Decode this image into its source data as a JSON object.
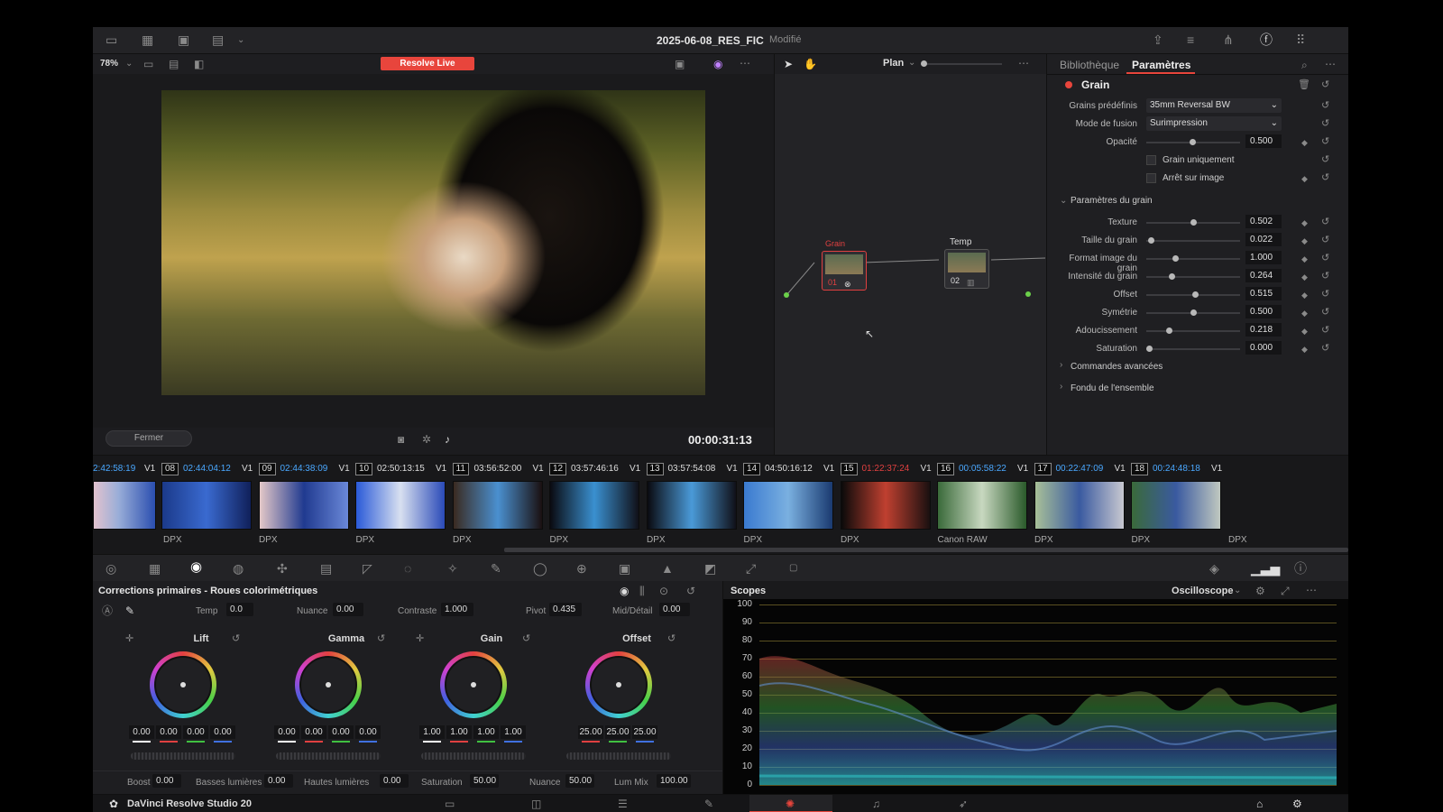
{
  "title_bar": {
    "project": "2025-06-08_RES_FIC",
    "status": "Modifié"
  },
  "viewer": {
    "zoom": "78%",
    "live_button": "Resolve Live",
    "timecode": "00:00:31:13",
    "close_button": "Fermer"
  },
  "node_editor": {
    "mode": "Plan",
    "nodes": [
      {
        "label": "Grain",
        "number": "01"
      },
      {
        "label": "Temp",
        "number": "02"
      }
    ]
  },
  "inspector": {
    "tabs": [
      "Bibliothèque",
      "Paramètres"
    ],
    "effect": "Grain",
    "preset_label": "Grains prédéfinis",
    "preset_value": "35mm Reversal BW",
    "blend_label": "Mode de fusion",
    "blend_value": "Surimpression",
    "opacity_label": "Opacité",
    "opacity_value": "0.500",
    "grain_only": "Grain uniquement",
    "freeze": "Arrêt sur image",
    "section_grain": "Paramètres du grain",
    "params": [
      {
        "label": "Texture",
        "value": "0.502",
        "pos": 0.5
      },
      {
        "label": "Taille du grain",
        "value": "0.022",
        "pos": 0.02
      },
      {
        "label": "Format image du grain",
        "value": "1.000",
        "pos": 0.3
      },
      {
        "label": "Intensité du grain",
        "value": "0.264",
        "pos": 0.25
      },
      {
        "label": "Offset",
        "value": "0.515",
        "pos": 0.52
      },
      {
        "label": "Symétrie",
        "value": "0.500",
        "pos": 0.5
      },
      {
        "label": "Adoucissement",
        "value": "0.218",
        "pos": 0.22
      },
      {
        "label": "Saturation",
        "value": "0.000",
        "pos": 0.0
      }
    ],
    "section_advanced": "Commandes avancées",
    "section_blend": "Fondu de l'ensemble"
  },
  "timeline": {
    "first_tc": "2:42:58:19",
    "first_track": "V1",
    "clips": [
      {
        "num": "08",
        "tc": "02:44:04:12",
        "track": "V1",
        "format": "DPX",
        "tc_color": "#4aa8ff"
      },
      {
        "num": "09",
        "tc": "02:44:38:09",
        "track": "V1",
        "format": "DPX",
        "tc_color": "#4aa8ff"
      },
      {
        "num": "10",
        "tc": "02:50:13:15",
        "track": "V1",
        "format": "DPX",
        "tc_color": "#dddddd"
      },
      {
        "num": "11",
        "tc": "03:56:52:00",
        "track": "V1",
        "format": "DPX",
        "tc_color": "#dddddd"
      },
      {
        "num": "12",
        "tc": "03:57:46:16",
        "track": "V1",
        "format": "DPX",
        "tc_color": "#dddddd"
      },
      {
        "num": "13",
        "tc": "03:57:54:08",
        "track": "V1",
        "format": "DPX",
        "tc_color": "#dddddd"
      },
      {
        "num": "14",
        "tc": "04:50:16:12",
        "track": "V1",
        "format": "DPX",
        "tc_color": "#dddddd"
      },
      {
        "num": "15",
        "tc": "01:22:37:24",
        "track": "V1",
        "format": "Canon RAW",
        "tc_color": "#e04040"
      },
      {
        "num": "16",
        "tc": "00:05:58:22",
        "track": "V1",
        "format": "DPX",
        "tc_color": "#4aa8ff"
      },
      {
        "num": "17",
        "tc": "00:22:47:09",
        "track": "V1",
        "format": "DPX",
        "tc_color": "#4aa8ff"
      },
      {
        "num": "18",
        "tc": "00:24:48:18",
        "track": "V1",
        "format": "DPX",
        "tc_color": "#4aa8ff"
      }
    ],
    "lead_format": "DPX"
  },
  "color": {
    "title": "Corrections primaires - Roues colorimétriques",
    "temp_label": "Temp",
    "temp": "0.0",
    "tint_label": "Nuance",
    "tint": "0.00",
    "contrast_label": "Contraste",
    "contrast": "1.000",
    "pivot_label": "Pivot",
    "pivot": "0.435",
    "middetail_label": "Mid/Détail",
    "middetail": "0.00",
    "wheels": [
      {
        "name": "Lift",
        "values": [
          "0.00",
          "0.00",
          "0.00",
          "0.00"
        ]
      },
      {
        "name": "Gamma",
        "values": [
          "0.00",
          "0.00",
          "0.00",
          "0.00"
        ]
      },
      {
        "name": "Gain",
        "values": [
          "1.00",
          "1.00",
          "1.00",
          "1.00"
        ]
      },
      {
        "name": "Offset",
        "values": [
          "25.00",
          "25.00",
          "25.00"
        ]
      }
    ],
    "bottom": [
      {
        "label": "Boost",
        "value": "0.00"
      },
      {
        "label": "Basses lumières",
        "value": "0.00"
      },
      {
        "label": "Hautes lumières",
        "value": "0.00"
      },
      {
        "label": "Saturation",
        "value": "50.00"
      },
      {
        "label": "Nuance",
        "value": "50.00"
      },
      {
        "label": "Lum Mix",
        "value": "100.00"
      }
    ]
  },
  "scopes": {
    "title": "Scopes",
    "mode": "Oscilloscope",
    "scale": [
      "100",
      "90",
      "80",
      "70",
      "60",
      "50",
      "40",
      "30",
      "20",
      "10",
      "0"
    ]
  },
  "status": {
    "app": "DaVinci Resolve Studio 20"
  },
  "colors": {
    "accent": "#e8453c",
    "live": "#e8453c",
    "blue_tc": "#4aa8ff"
  }
}
